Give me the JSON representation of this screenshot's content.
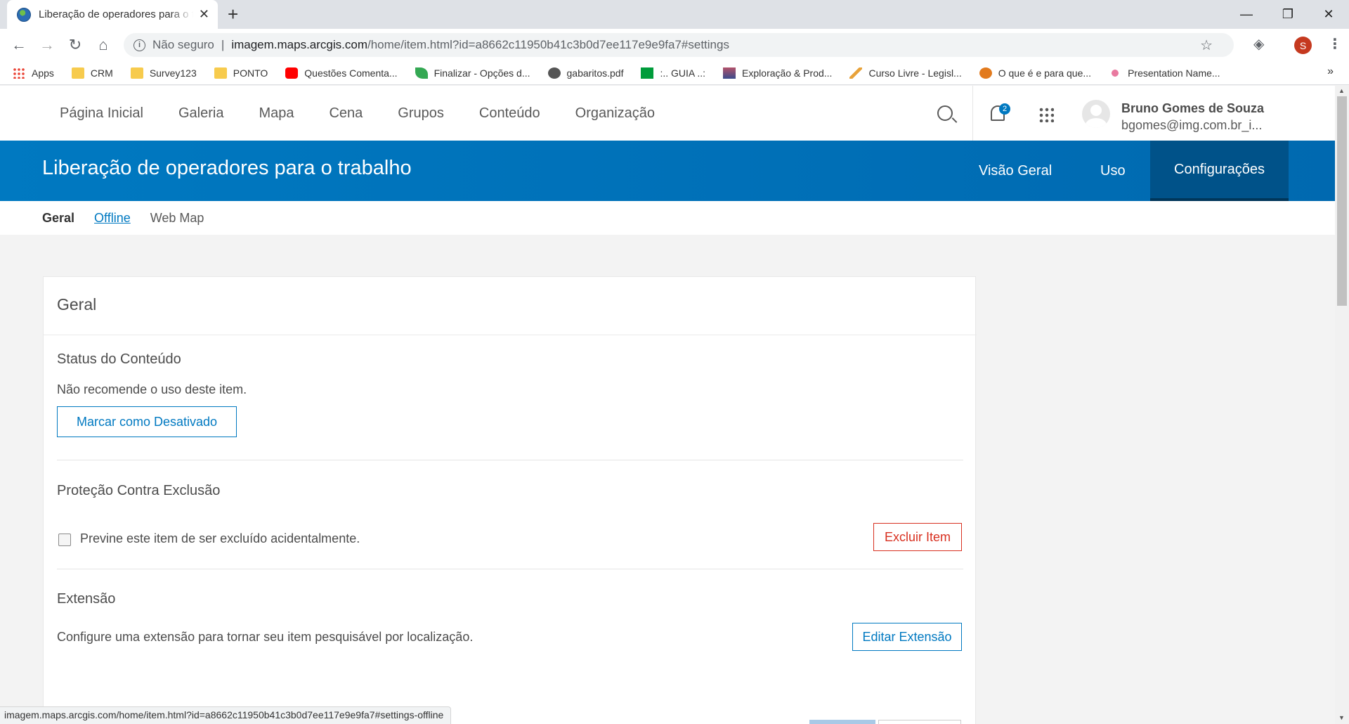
{
  "browser": {
    "tab_title": "Liberação de operadores para o trabalho",
    "new_tab_label": "+",
    "window_controls": {
      "minimize": "—",
      "maximize": "❐",
      "close": "✕"
    },
    "security_label": "Não seguro",
    "url_host": "imagem.maps.arcgis.com",
    "url_path": "/home/item.html?id=a8662c11950b41c3b0d7ee117e9e9fa7#settings",
    "profile_initial": "S",
    "bookmarks": [
      {
        "label": "Apps",
        "icon": "apps-grid-icon"
      },
      {
        "label": "CRM",
        "icon": "folder-icon"
      },
      {
        "label": "Survey123",
        "icon": "folder-icon"
      },
      {
        "label": "PONTO",
        "icon": "folder-icon"
      },
      {
        "label": "Questões Comenta...",
        "icon": "youtube-icon"
      },
      {
        "label": "Finalizar - Opções d...",
        "icon": "leaf-icon"
      },
      {
        "label": "gabaritos.pdf",
        "icon": "globe-icon"
      },
      {
        "label": ":.. GUIA ..:",
        "icon": "flag-icon"
      },
      {
        "label": "Exploração & Prod...",
        "icon": "image-icon"
      },
      {
        "label": "Curso Livre - Legisl...",
        "icon": "plane-icon"
      },
      {
        "label": "O que é e para que...",
        "icon": "orange-circle-icon"
      },
      {
        "label": "Presentation Name...",
        "icon": "flower-icon"
      }
    ],
    "bookmarks_more": "»",
    "status_url": "imagem.maps.arcgis.com/home/item.html?id=a8662c11950b41c3b0d7ee117e9e9fa7#settings-offline"
  },
  "portal": {
    "nav": [
      "Página Inicial",
      "Galeria",
      "Mapa",
      "Cena",
      "Grupos",
      "Conteúdo",
      "Organização"
    ],
    "notifications_count": "2",
    "user_name": "Bruno Gomes de Souza",
    "user_email": "bgomes@img.com.br_i..."
  },
  "item": {
    "title": "Liberação de operadores para o trabalho",
    "tabs": [
      "Visão Geral",
      "Uso",
      "Configurações"
    ],
    "active_tab": "Configurações",
    "subtabs": [
      "Geral",
      "Offline",
      "Web Map"
    ]
  },
  "settings": {
    "heading": "Geral",
    "content_status": {
      "title": "Status do Conteúdo",
      "description": "Não recomende o uso deste item.",
      "button": "Marcar como Desativado"
    },
    "delete_protection": {
      "title": "Proteção Contra Exclusão",
      "checkbox_label": "Previne este item de ser excluído acidentalmente.",
      "checked": false,
      "button": "Excluir Item"
    },
    "extent": {
      "title": "Extensão",
      "description": "Configure uma extensão para tornar seu item pesquisável por localização.",
      "button": "Editar Extensão"
    }
  },
  "colors": {
    "accent": "#0079c1",
    "banner_active": "#005289",
    "danger": "#d83020"
  }
}
